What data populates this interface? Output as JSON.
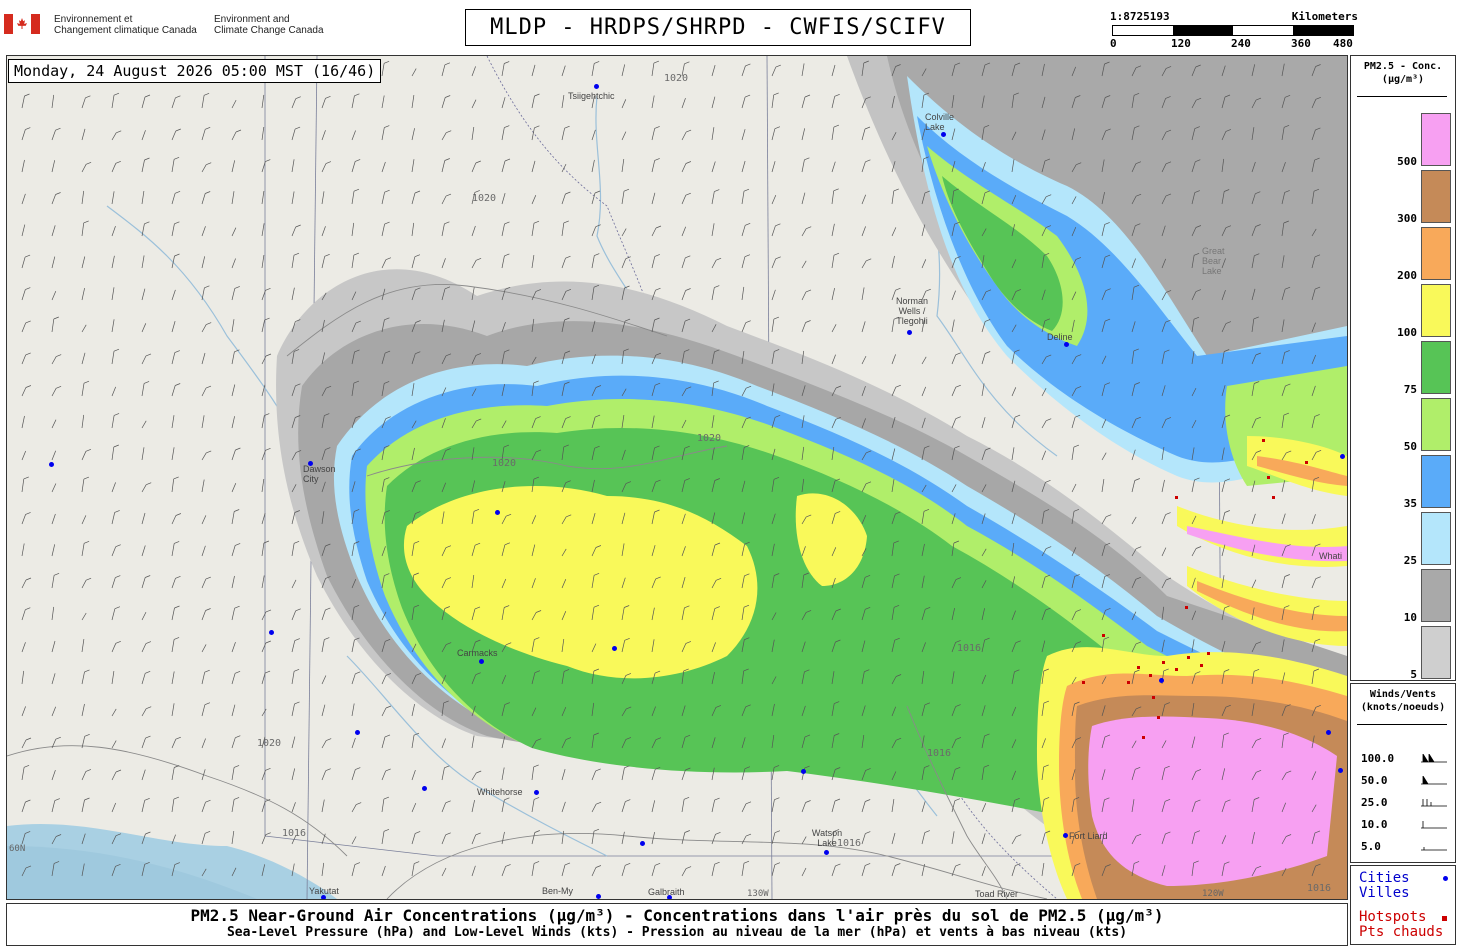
{
  "header": {
    "dept_fr_1": "Environnement et",
    "dept_fr_2": "Changement climatique Canada",
    "dept_en_1": "Environment and",
    "dept_en_2": "Climate Change Canada",
    "title": "MLDP - HRDPS/SHRPD - CWFIS/SCIFV"
  },
  "scale": {
    "ratio": "1:8725193",
    "unit": "Kilometers",
    "ticks": [
      "0",
      "120",
      "240",
      "360",
      "480"
    ]
  },
  "map": {
    "datetime": "Monday, 24 August 2026 05:00 MST (16/46)",
    "cities": [
      {
        "name": "Tsiigehtchic"
      },
      {
        "name": "Colville Lake"
      },
      {
        "name": "Norman Wells / Tlegohli"
      },
      {
        "name": "Deline"
      },
      {
        "name": "Dawson City"
      },
      {
        "name": "Carmacks"
      },
      {
        "name": "Whitehorse"
      },
      {
        "name": "Watson Lake"
      },
      {
        "name": "Fort Liard"
      },
      {
        "name": "Yakutat"
      },
      {
        "name": "Ben-My"
      },
      {
        "name": "Galbraith"
      },
      {
        "name": "Toad River"
      },
      {
        "name": "Great Bear Lake"
      },
      {
        "name": "Whati"
      }
    ],
    "isobar_labels": [
      "1020",
      "1016",
      "1020",
      "1016",
      "1020",
      "1020",
      "1016",
      "1016",
      "1020",
      "1016"
    ],
    "graticule_labels": [
      "60N",
      "130W",
      "120W"
    ]
  },
  "legend_pm": {
    "title_1": "PM2.5 - Conc.",
    "title_2": "(μg/m³)",
    "bins": [
      {
        "label": "500",
        "color": "#f7a0f2"
      },
      {
        "label": "300",
        "color": "#c58a58"
      },
      {
        "label": "200",
        "color": "#f8a95a"
      },
      {
        "label": "100",
        "color": "#f9f95a"
      },
      {
        "label": "75",
        "color": "#57c456"
      },
      {
        "label": "50",
        "color": "#b0ee6a"
      },
      {
        "label": "35",
        "color": "#5aabf9"
      },
      {
        "label": "25",
        "color": "#b4e6fb"
      },
      {
        "label": "10",
        "color": "#a9a9a9"
      },
      {
        "label": "5",
        "color": "#cfcfcf"
      }
    ]
  },
  "legend_wind": {
    "title_1": "Winds/Vents",
    "title_2": "(knots/noeuds)",
    "rows": [
      "100.0",
      "50.0",
      "25.0",
      "10.0",
      "5.0"
    ]
  },
  "legend_marks": {
    "cities_en": "Cities",
    "cities_fr": "Villes",
    "hotspots_en": "Hotspots",
    "hotspots_fr": "Pts chauds"
  },
  "caption": {
    "line1": "PM2.5 Near-Ground Air Concentrations (μg/m³) - Concentrations dans l'air près du sol de PM2.5 (μg/m³)",
    "line2": "Sea-Level Pressure (hPa) and Low-Level Winds (kts) - Pression au niveau de la mer (hPa) et vents à bas niveau (kts)"
  }
}
